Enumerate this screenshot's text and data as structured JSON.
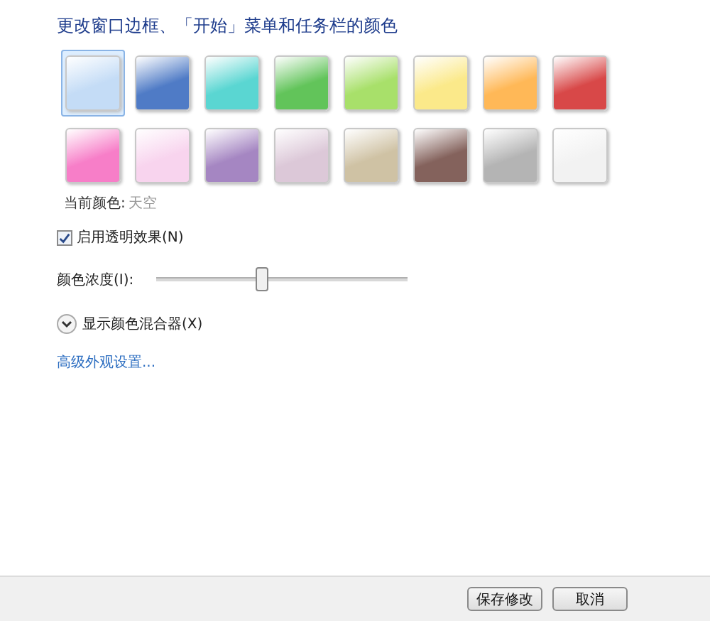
{
  "title": "更改窗口边框、「开始」菜单和任务栏的颜色",
  "swatches": [
    {
      "color": "#c4dcf6",
      "selected": true
    },
    {
      "color": "#4f7bc6",
      "selected": false
    },
    {
      "color": "#5ad6d2",
      "selected": false
    },
    {
      "color": "#62c45a",
      "selected": false
    },
    {
      "color": "#a8e06a",
      "selected": false
    },
    {
      "color": "#fbe98a",
      "selected": false
    },
    {
      "color": "#ffb857",
      "selected": false
    },
    {
      "color": "#d84848",
      "selected": false
    },
    {
      "color": "#f77ec8",
      "selected": false
    },
    {
      "color": "#f8d4ee",
      "selected": false
    },
    {
      "color": "#a586c2",
      "selected": false
    },
    {
      "color": "#dcc8d8",
      "selected": false
    },
    {
      "color": "#cfc2a4",
      "selected": false
    },
    {
      "color": "#84625c",
      "selected": false
    },
    {
      "color": "#b4b4b4",
      "selected": false
    },
    {
      "color": "#f2f2f2",
      "selected": false
    }
  ],
  "current_color": {
    "label": "当前颜色:",
    "value": "天空"
  },
  "transparency": {
    "label": "启用透明效果(N)",
    "checked": true
  },
  "intensity": {
    "label": "颜色浓度(I):",
    "level": 0.42
  },
  "mixer": {
    "label": "显示颜色混合器(X)",
    "expanded": false
  },
  "advanced_link": "高级外观设置...",
  "buttons": [
    "保存修改",
    "取消"
  ]
}
